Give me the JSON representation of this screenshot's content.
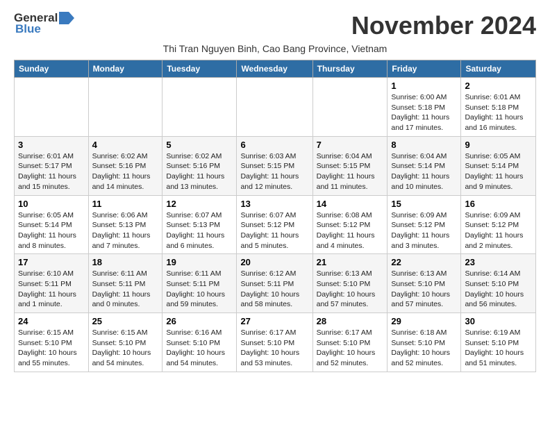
{
  "header": {
    "logo_general": "General",
    "logo_blue": "Blue",
    "title": "November 2024",
    "location": "Thi Tran Nguyen Binh, Cao Bang Province, Vietnam"
  },
  "weekdays": [
    "Sunday",
    "Monday",
    "Tuesday",
    "Wednesday",
    "Thursday",
    "Friday",
    "Saturday"
  ],
  "weeks": [
    [
      {
        "day": "",
        "info": ""
      },
      {
        "day": "",
        "info": ""
      },
      {
        "day": "",
        "info": ""
      },
      {
        "day": "",
        "info": ""
      },
      {
        "day": "",
        "info": ""
      },
      {
        "day": "1",
        "info": "Sunrise: 6:00 AM\nSunset: 5:18 PM\nDaylight: 11 hours and 17 minutes."
      },
      {
        "day": "2",
        "info": "Sunrise: 6:01 AM\nSunset: 5:18 PM\nDaylight: 11 hours and 16 minutes."
      }
    ],
    [
      {
        "day": "3",
        "info": "Sunrise: 6:01 AM\nSunset: 5:17 PM\nDaylight: 11 hours and 15 minutes."
      },
      {
        "day": "4",
        "info": "Sunrise: 6:02 AM\nSunset: 5:16 PM\nDaylight: 11 hours and 14 minutes."
      },
      {
        "day": "5",
        "info": "Sunrise: 6:02 AM\nSunset: 5:16 PM\nDaylight: 11 hours and 13 minutes."
      },
      {
        "day": "6",
        "info": "Sunrise: 6:03 AM\nSunset: 5:15 PM\nDaylight: 11 hours and 12 minutes."
      },
      {
        "day": "7",
        "info": "Sunrise: 6:04 AM\nSunset: 5:15 PM\nDaylight: 11 hours and 11 minutes."
      },
      {
        "day": "8",
        "info": "Sunrise: 6:04 AM\nSunset: 5:14 PM\nDaylight: 11 hours and 10 minutes."
      },
      {
        "day": "9",
        "info": "Sunrise: 6:05 AM\nSunset: 5:14 PM\nDaylight: 11 hours and 9 minutes."
      }
    ],
    [
      {
        "day": "10",
        "info": "Sunrise: 6:05 AM\nSunset: 5:14 PM\nDaylight: 11 hours and 8 minutes."
      },
      {
        "day": "11",
        "info": "Sunrise: 6:06 AM\nSunset: 5:13 PM\nDaylight: 11 hours and 7 minutes."
      },
      {
        "day": "12",
        "info": "Sunrise: 6:07 AM\nSunset: 5:13 PM\nDaylight: 11 hours and 6 minutes."
      },
      {
        "day": "13",
        "info": "Sunrise: 6:07 AM\nSunset: 5:12 PM\nDaylight: 11 hours and 5 minutes."
      },
      {
        "day": "14",
        "info": "Sunrise: 6:08 AM\nSunset: 5:12 PM\nDaylight: 11 hours and 4 minutes."
      },
      {
        "day": "15",
        "info": "Sunrise: 6:09 AM\nSunset: 5:12 PM\nDaylight: 11 hours and 3 minutes."
      },
      {
        "day": "16",
        "info": "Sunrise: 6:09 AM\nSunset: 5:12 PM\nDaylight: 11 hours and 2 minutes."
      }
    ],
    [
      {
        "day": "17",
        "info": "Sunrise: 6:10 AM\nSunset: 5:11 PM\nDaylight: 11 hours and 1 minute."
      },
      {
        "day": "18",
        "info": "Sunrise: 6:11 AM\nSunset: 5:11 PM\nDaylight: 11 hours and 0 minutes."
      },
      {
        "day": "19",
        "info": "Sunrise: 6:11 AM\nSunset: 5:11 PM\nDaylight: 10 hours and 59 minutes."
      },
      {
        "day": "20",
        "info": "Sunrise: 6:12 AM\nSunset: 5:11 PM\nDaylight: 10 hours and 58 minutes."
      },
      {
        "day": "21",
        "info": "Sunrise: 6:13 AM\nSunset: 5:10 PM\nDaylight: 10 hours and 57 minutes."
      },
      {
        "day": "22",
        "info": "Sunrise: 6:13 AM\nSunset: 5:10 PM\nDaylight: 10 hours and 57 minutes."
      },
      {
        "day": "23",
        "info": "Sunrise: 6:14 AM\nSunset: 5:10 PM\nDaylight: 10 hours and 56 minutes."
      }
    ],
    [
      {
        "day": "24",
        "info": "Sunrise: 6:15 AM\nSunset: 5:10 PM\nDaylight: 10 hours and 55 minutes."
      },
      {
        "day": "25",
        "info": "Sunrise: 6:15 AM\nSunset: 5:10 PM\nDaylight: 10 hours and 54 minutes."
      },
      {
        "day": "26",
        "info": "Sunrise: 6:16 AM\nSunset: 5:10 PM\nDaylight: 10 hours and 54 minutes."
      },
      {
        "day": "27",
        "info": "Sunrise: 6:17 AM\nSunset: 5:10 PM\nDaylight: 10 hours and 53 minutes."
      },
      {
        "day": "28",
        "info": "Sunrise: 6:17 AM\nSunset: 5:10 PM\nDaylight: 10 hours and 52 minutes."
      },
      {
        "day": "29",
        "info": "Sunrise: 6:18 AM\nSunset: 5:10 PM\nDaylight: 10 hours and 52 minutes."
      },
      {
        "day": "30",
        "info": "Sunrise: 6:19 AM\nSunset: 5:10 PM\nDaylight: 10 hours and 51 minutes."
      }
    ]
  ]
}
